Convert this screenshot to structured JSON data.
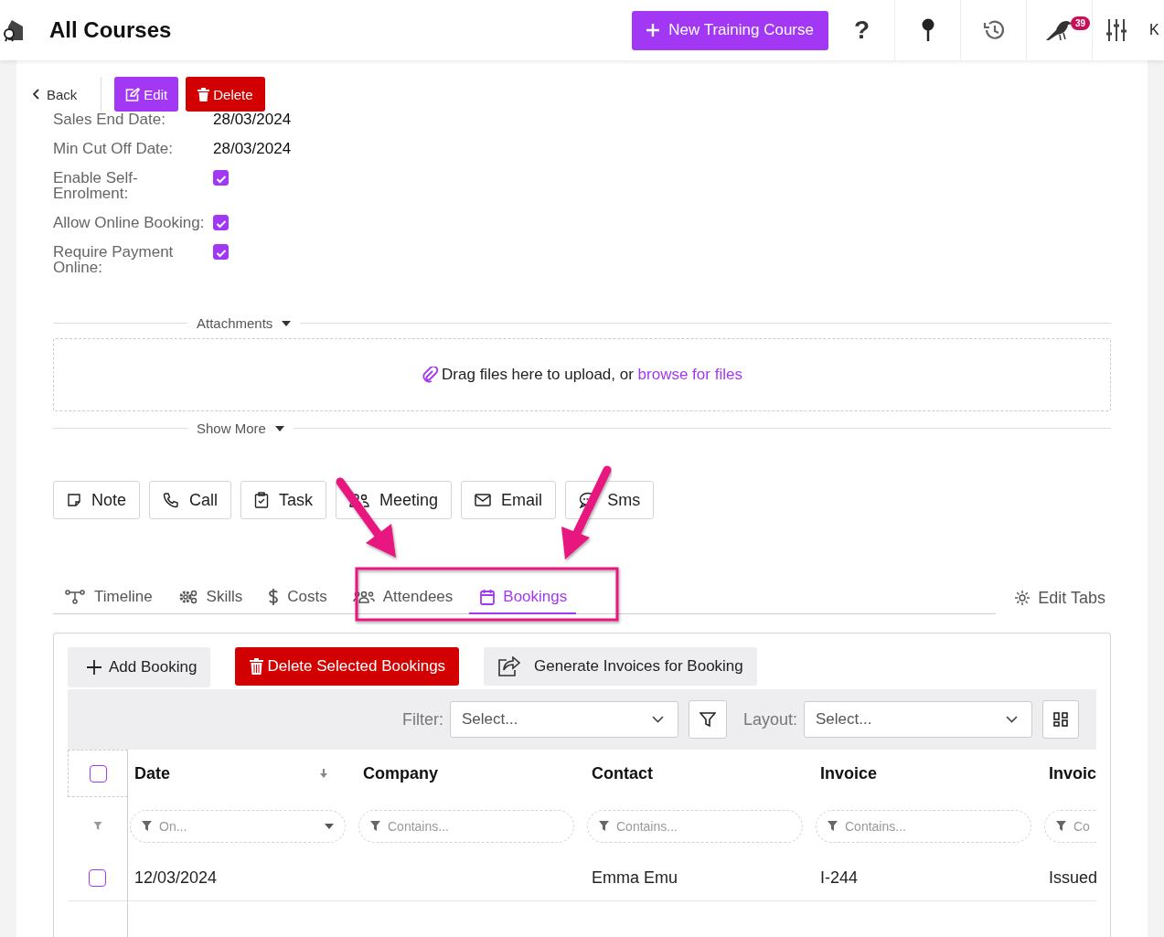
{
  "header": {
    "title": "All Courses",
    "new_button": "New Training Course",
    "help": "?",
    "notification_count": "39",
    "user_initial": "K"
  },
  "toolbar": {
    "back": "Back",
    "edit": "Edit",
    "delete": "Delete"
  },
  "fields": [
    {
      "kind": "text",
      "label": "Sales End Date:",
      "value": "28/03/2024"
    },
    {
      "kind": "text",
      "label": "Min Cut Off Date:",
      "value": "28/03/2024"
    },
    {
      "kind": "checkbox",
      "label": "Enable Self-Enrolment:",
      "checked": true
    },
    {
      "kind": "checkbox",
      "label": "Allow Online Booking:",
      "checked": true
    },
    {
      "kind": "checkbox",
      "label": "Require Payment Online:",
      "checked": true
    }
  ],
  "attachments": {
    "label": "Attachments",
    "drop_text": "Drag files here to upload, or ",
    "browse_link": "browse for files"
  },
  "show_more": "Show More",
  "activities": [
    {
      "kind": "note",
      "label": "Note"
    },
    {
      "kind": "call",
      "label": "Call"
    },
    {
      "kind": "task",
      "label": "Task"
    },
    {
      "kind": "meeting",
      "label": "Meeting"
    },
    {
      "kind": "email",
      "label": "Email"
    },
    {
      "kind": "sms",
      "label": "Sms"
    }
  ],
  "tabs": [
    {
      "kind": "timeline",
      "label": "Timeline",
      "selected": false
    },
    {
      "kind": "skills",
      "label": "Skills",
      "selected": false
    },
    {
      "kind": "costs",
      "label": "Costs",
      "selected": false
    },
    {
      "kind": "attendees",
      "label": "Attendees",
      "selected": false
    },
    {
      "kind": "bookings",
      "label": "Bookings",
      "selected": true
    }
  ],
  "edit_tabs": "Edit Tabs",
  "bookings": {
    "actions": [
      {
        "kind": "add",
        "label": "Add Booking"
      },
      {
        "kind": "delete",
        "label": "Delete Selected Bookings"
      },
      {
        "kind": "invoice",
        "label": "Generate Invoices for Booking"
      }
    ],
    "filter_label": "Filter:",
    "filter_placeholder": "Select...",
    "layout_label": "Layout:",
    "layout_placeholder": "Select...",
    "select_all_checked": false,
    "columns": [
      {
        "label": "Date",
        "filter_placeholder": "On...",
        "sorted": true
      },
      {
        "label": "Company",
        "filter_placeholder": "Contains...",
        "sorted": false
      },
      {
        "label": "Contact",
        "filter_placeholder": "Contains...",
        "sorted": false
      },
      {
        "label": "Invoice",
        "filter_placeholder": "Contains...",
        "sorted": false
      },
      {
        "label": "Invoic",
        "filter_placeholder": "Co",
        "sorted": false
      }
    ],
    "rows": [
      {
        "selected": false,
        "date": "12/03/2024",
        "contact": "Emma Emu",
        "invoice": "I-244",
        "column_5": "Issued"
      }
    ]
  }
}
